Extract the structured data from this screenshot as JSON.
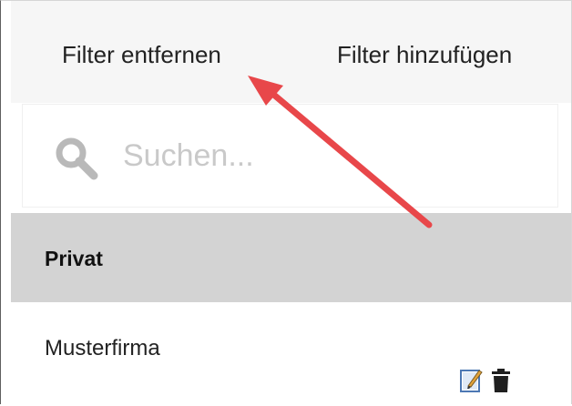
{
  "header": {
    "remove_filter_label": "Filter entfernen",
    "add_filter_label": "Filter hinzufügen"
  },
  "search": {
    "placeholder": "Suchen...",
    "icon": "search-icon"
  },
  "list": {
    "group_label": "Privat",
    "items": [
      {
        "label": "Musterfirma",
        "actions": [
          "edit-icon",
          "trash-icon"
        ]
      }
    ]
  },
  "annotation": {
    "arrow_color": "#e8474a"
  },
  "colors": {
    "topbar_bg": "#f6f6f6",
    "group_bg": "#d3d3d3",
    "search_icon": "#b9b9b9",
    "placeholder": "#c9c9c9"
  }
}
